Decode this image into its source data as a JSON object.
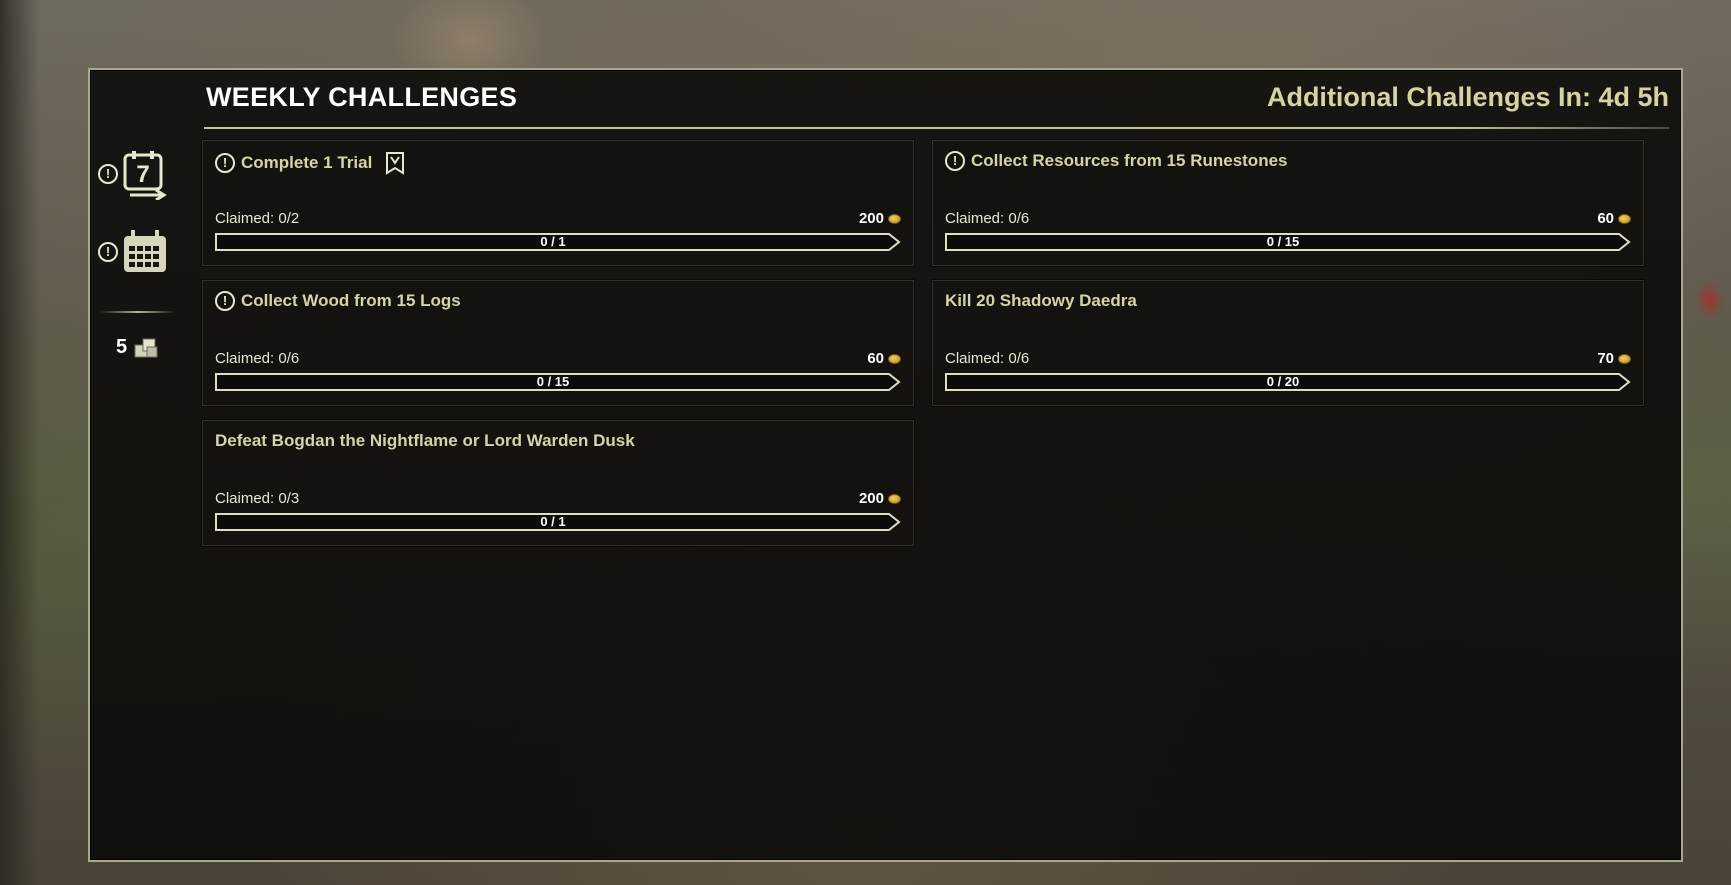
{
  "header": {
    "title": "WEEKLY CHALLENGES",
    "timer": "Additional Challenges In: 4d 5h"
  },
  "sidebar": {
    "weekly_icon_number": "7",
    "alert_glyph": "!",
    "currency_count": "5"
  },
  "colors": {
    "accent_text": "#d7d3a8",
    "border": "#a9a78f",
    "gold": "#d4a93a"
  },
  "challenges": [
    {
      "title": "Complete 1 Trial",
      "has_alert": true,
      "has_trial_icon": true,
      "claimed": "Claimed: 0/2",
      "reward": "200",
      "progress_label": "0 / 1",
      "progress_fraction": 0
    },
    {
      "title": "Collect Resources from 15 Runestones",
      "has_alert": true,
      "has_trial_icon": false,
      "claimed": "Claimed: 0/6",
      "reward": "60",
      "progress_label": "0 / 15",
      "progress_fraction": 0
    },
    {
      "title": "Collect Wood from 15 Logs",
      "has_alert": true,
      "has_trial_icon": false,
      "claimed": "Claimed: 0/6",
      "reward": "60",
      "progress_label": "0 / 15",
      "progress_fraction": 0
    },
    {
      "title": "Kill 20 Shadowy Daedra",
      "has_alert": false,
      "has_trial_icon": false,
      "claimed": "Claimed: 0/6",
      "reward": "70",
      "progress_label": "0 / 20",
      "progress_fraction": 0
    },
    {
      "title": "Defeat Bogdan the Nightflame or Lord Warden Dusk",
      "has_alert": false,
      "has_trial_icon": false,
      "claimed": "Claimed: 0/3",
      "reward": "200",
      "progress_label": "0 / 1",
      "progress_fraction": 0
    }
  ]
}
